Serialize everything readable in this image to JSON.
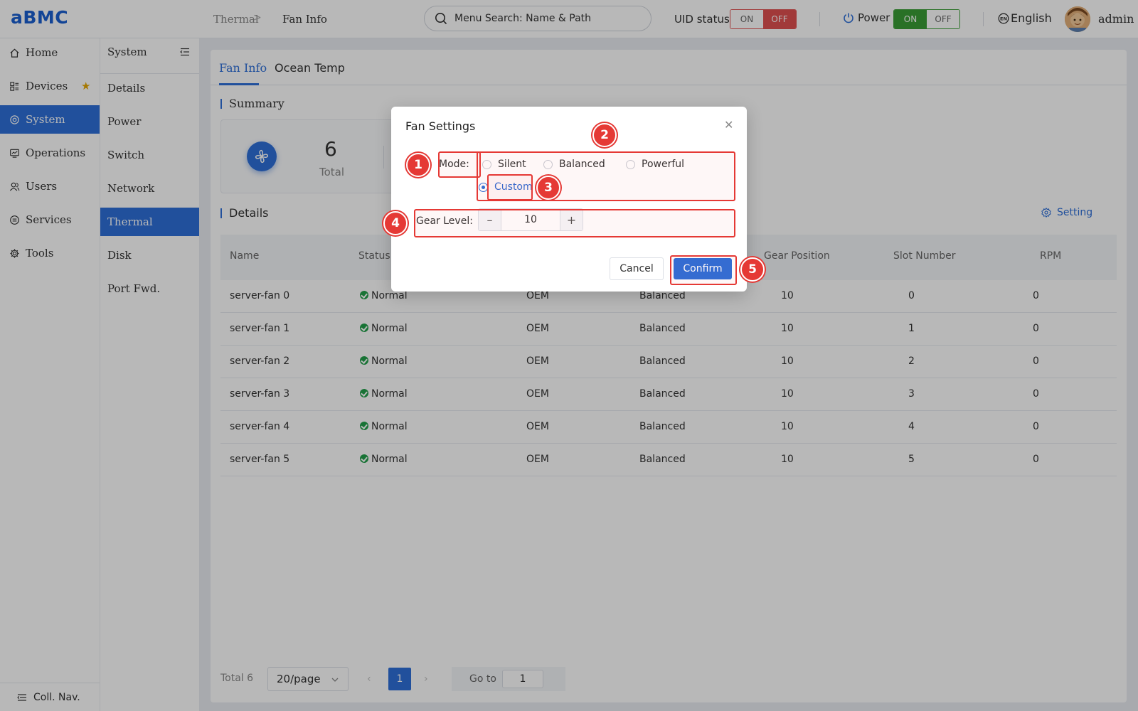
{
  "header": {
    "logo": "aBMC",
    "breadcrumb": [
      "Thermal",
      "Fan Info"
    ],
    "breadcrumb_sep": ">",
    "search_placeholder": "Menu Search: Name & Path",
    "uid_label": "UID status",
    "uid_on": "ON",
    "uid_off": "OFF",
    "power_label": "Power",
    "power_on": "ON",
    "power_off": "OFF",
    "language": "English",
    "user": "admin"
  },
  "nav_primary": {
    "items": [
      {
        "label": "Home",
        "icon": "home-icon"
      },
      {
        "label": "Devices",
        "icon": "devices-icon"
      },
      {
        "label": "System",
        "icon": "system-icon"
      },
      {
        "label": "Operations",
        "icon": "operations-icon"
      },
      {
        "label": "Users",
        "icon": "users-icon"
      },
      {
        "label": "Services",
        "icon": "services-icon"
      },
      {
        "label": "Tools",
        "icon": "tools-icon"
      }
    ],
    "active": "System",
    "collapse_label": "Coll. Nav."
  },
  "nav_secondary": {
    "title": "System",
    "items": [
      "Details",
      "Power",
      "Switch",
      "Network",
      "Thermal",
      "Disk",
      "Port Fwd."
    ],
    "active": "Thermal"
  },
  "tabs": [
    "Fan Info",
    "Ocean Temp"
  ],
  "summary": {
    "title": "Summary",
    "total_value": "6",
    "total_label": "Total"
  },
  "details": {
    "title": "Details",
    "setting_label": "Setting",
    "columns": [
      "Name",
      "Status",
      "",
      "",
      "Gear Position",
      "Slot Number",
      "RPM"
    ],
    "rows": [
      {
        "name": "server-fan 0",
        "status": "Normal",
        "model": "OEM",
        "mode": "Balanced",
        "gear": "10",
        "slot": "0",
        "rpm": "0"
      },
      {
        "name": "server-fan 1",
        "status": "Normal",
        "model": "OEM",
        "mode": "Balanced",
        "gear": "10",
        "slot": "1",
        "rpm": "0"
      },
      {
        "name": "server-fan 2",
        "status": "Normal",
        "model": "OEM",
        "mode": "Balanced",
        "gear": "10",
        "slot": "2",
        "rpm": "0"
      },
      {
        "name": "server-fan 3",
        "status": "Normal",
        "model": "OEM",
        "mode": "Balanced",
        "gear": "10",
        "slot": "3",
        "rpm": "0"
      },
      {
        "name": "server-fan 4",
        "status": "Normal",
        "model": "OEM",
        "mode": "Balanced",
        "gear": "10",
        "slot": "4",
        "rpm": "0"
      },
      {
        "name": "server-fan 5",
        "status": "Normal",
        "model": "OEM",
        "mode": "Balanced",
        "gear": "10",
        "slot": "5",
        "rpm": "0"
      }
    ]
  },
  "pagination": {
    "total": "Total 6",
    "page_size": "20/page",
    "current_page": "1",
    "goto_label": "Go to",
    "goto_value": "1"
  },
  "modal": {
    "title": "Fan Settings",
    "mode_label": "Mode:",
    "modes": [
      "Silent",
      "Balanced",
      "Powerful",
      "Custom"
    ],
    "selected_mode": "Custom",
    "gear_label": "Gear Level:",
    "gear_value": "10",
    "cancel": "Cancel",
    "confirm": "Confirm"
  },
  "annotations": [
    "1",
    "2",
    "3",
    "4",
    "5"
  ],
  "colors": {
    "accent": "#2e6fd8",
    "annotation": "#e53935",
    "uid_off": "#e05050",
    "power_on": "#3a9d35",
    "status_ok": "#22a04a"
  }
}
